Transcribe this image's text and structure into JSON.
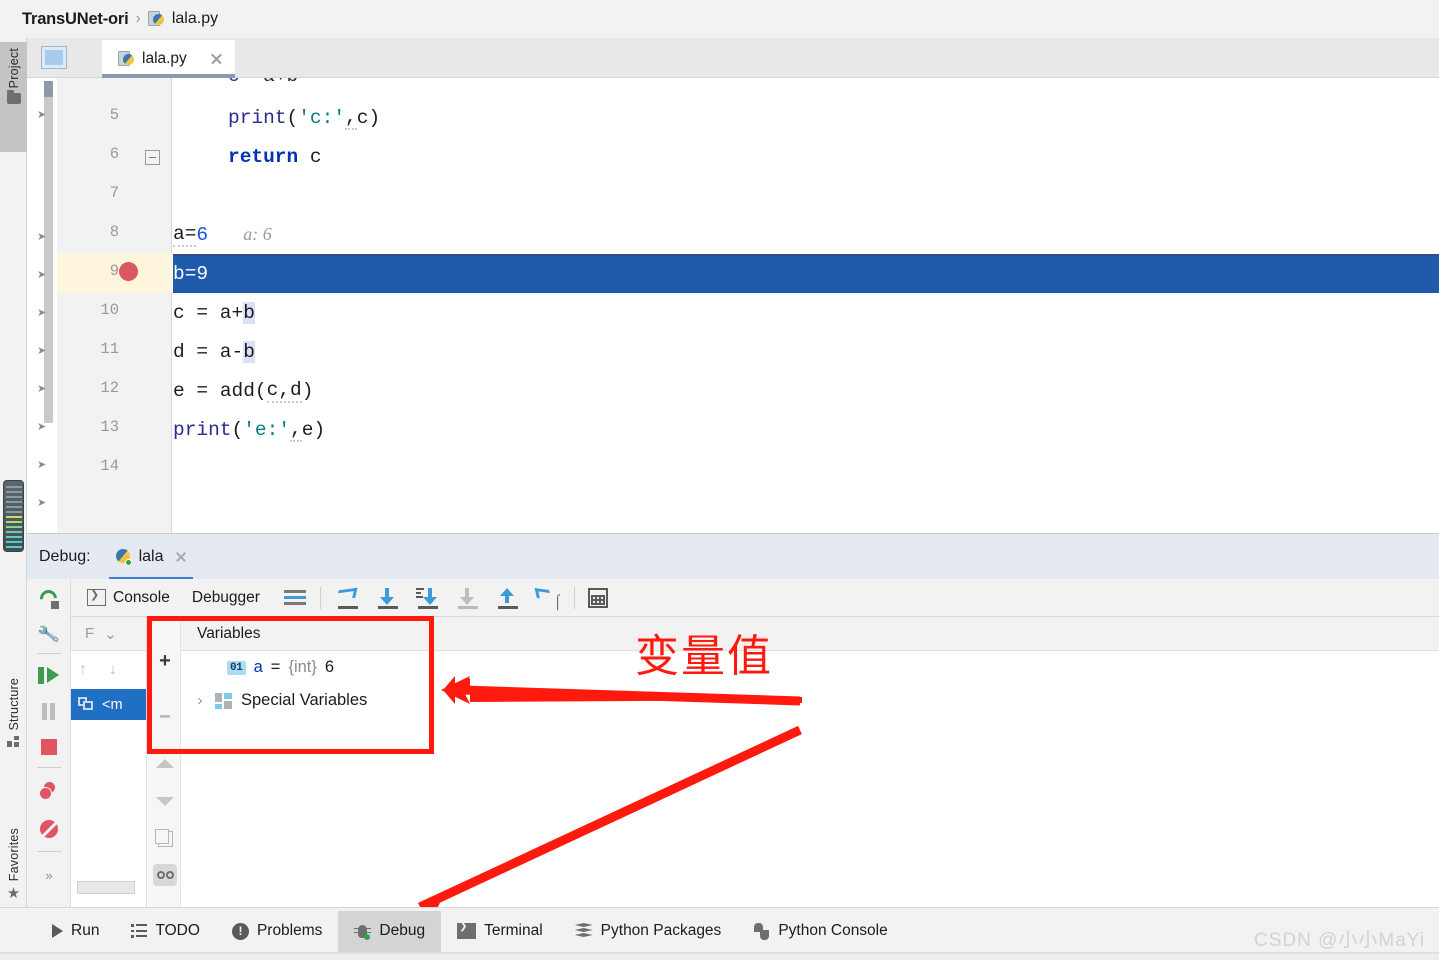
{
  "breadcrumb": {
    "project": "TransUNet-ori",
    "separator": "›",
    "file": "lala.py"
  },
  "left_rail": {
    "project_label": "Project",
    "structure_label": "Structure",
    "favorites_label": "Favorites"
  },
  "editor_tabs": {
    "active_tab": "lala.py"
  },
  "editor": {
    "lines": [
      {
        "number": "5",
        "indent": true,
        "text": "print('c:',c)"
      },
      {
        "number": "6",
        "indent": true,
        "text": "return c"
      },
      {
        "number": "7",
        "indent": false,
        "text": ""
      },
      {
        "number": "8",
        "indent": false,
        "text": "a=6",
        "hint": "a: 6"
      },
      {
        "number": "9",
        "indent": false,
        "text": "b=9",
        "highlighted": true,
        "breakpoint": true
      },
      {
        "number": "10",
        "indent": false,
        "text": "c = a+b"
      },
      {
        "number": "11",
        "indent": false,
        "text": "d = a-b"
      },
      {
        "number": "12",
        "indent": false,
        "text": "e = add(c,d)"
      },
      {
        "number": "13",
        "indent": false,
        "text": "print('e:',e)"
      },
      {
        "number": "14",
        "indent": false,
        "text": ""
      }
    ],
    "tokens": {
      "print": "print",
      "open_paren": "(",
      "close_paren": ")",
      "str_c": "'c:'",
      "str_e": "'e:'",
      "comma": ",",
      "var_c": "c",
      "var_e": "e",
      "return_kw": "return",
      "line8_name": "a=",
      "line8_value": "6",
      "line8_hint": "a: 6",
      "line9_name": "b=",
      "line9_value": "9",
      "line10": "c = a+b",
      "line11": "d = a-b",
      "line12_lhs": "e = ",
      "line12_call": "add",
      "line12_args": "c,d"
    },
    "highlight_color": "#1f5baa",
    "breakpoint_color": "#db5860"
  },
  "debug_window": {
    "title": "Debug:",
    "run_config_tab": "lala",
    "toolbar": {
      "console_label": "Console",
      "debugger_label": "Debugger"
    },
    "left_tools": [
      "rerun-icon",
      "settings-wrench-icon",
      "resume-program-icon",
      "pause-program-icon",
      "stop-icon",
      "view-breakpoints-icon",
      "mute-breakpoints-icon",
      "more-icon"
    ],
    "step_tools": [
      "show-execution-point-icon",
      "step-over-icon",
      "step-into-icon",
      "force-step-into-icon",
      "step-out-icon",
      "run-to-cursor-icon",
      "evaluate-expression-icon"
    ],
    "more_chevrons": "»"
  },
  "frames": {
    "header_label": "F",
    "header_chevron": "⌄",
    "selected_frame": "<m"
  },
  "variables": {
    "panel_title": "Variables",
    "rows": [
      {
        "icon": "01",
        "name": "a",
        "equals": "=",
        "type": "{int}",
        "value": "6",
        "expandable": false
      },
      {
        "chevron": "›",
        "name": "Special Variables",
        "expandable": true
      }
    ],
    "tools": {
      "add": "+",
      "remove": "−"
    }
  },
  "annotations": {
    "note_text": "变量值",
    "color": "#ff1a0d"
  },
  "statusbar": {
    "items": [
      {
        "label": "Run",
        "icon": "play-icon",
        "active": false
      },
      {
        "label": "TODO",
        "icon": "todo-list-icon",
        "active": false
      },
      {
        "label": "Problems",
        "icon": "problems-icon",
        "active": false
      },
      {
        "label": "Debug",
        "icon": "bug-icon",
        "active": true
      },
      {
        "label": "Terminal",
        "icon": "terminal-icon",
        "active": false
      },
      {
        "label": "Python Packages",
        "icon": "packages-icon",
        "active": false
      },
      {
        "label": "Python Console",
        "icon": "python-console-icon",
        "active": false
      }
    ],
    "watermark": "CSDN @小小MaYi"
  }
}
